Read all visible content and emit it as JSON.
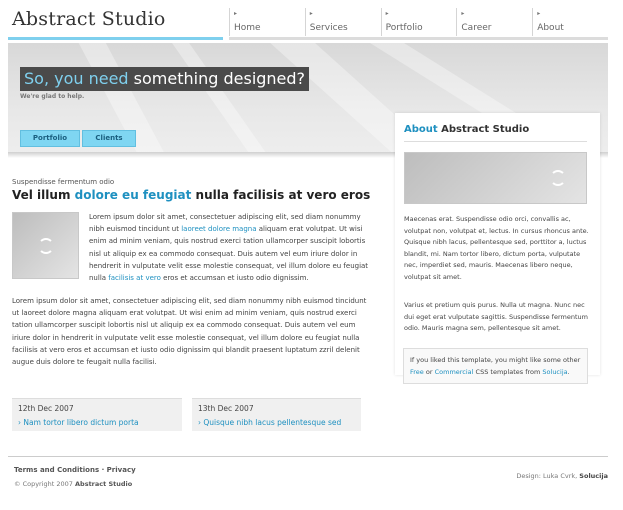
{
  "header": {
    "logo": "Abstract Studio",
    "nav": [
      {
        "label": "Home"
      },
      {
        "label": "Services"
      },
      {
        "label": "Portfolio"
      },
      {
        "label": "Career"
      },
      {
        "label": "About"
      }
    ]
  },
  "banner": {
    "title_highlight": "So, you need",
    "title_rest": " something designed?",
    "subtitle": "We're glad to help.",
    "buttons": [
      "Portfolio",
      "Clients"
    ]
  },
  "main": {
    "kicker": "Suspendisse fermentum odio",
    "headline_a": "Vel illum ",
    "headline_link": "dolore eu feugiat",
    "headline_b": " nulla facilisis at vero eros",
    "para1_a": "Lorem ipsum dolor sit amet, consectetuer adipiscing elit, sed diam nonummy nibh euismod tincidunt ut ",
    "para1_link1": "laoreet dolore magna",
    "para1_b": " aliquam erat volutpat. Ut wisi enim ad minim veniam, quis nostrud exerci tation ullamcorper suscipit lobortis nisl ut aliquip ex ea commodo consequat. Duis autem vel eum iriure dolor in hendrerit in vulputate velit esse molestie consequat, vel illum dolore eu feugiat nulla ",
    "para1_link2": "facilisis at vero",
    "para1_c": " eros et accumsan et iusto odio dignissim.",
    "para2": "Lorem ipsum dolor sit amet, consectetuer adipiscing elit, sed diam nonummy nibh euismod tincidunt ut laoreet dolore magna aliquam erat volutpat. Ut wisi enim ad minim veniam, quis nostrud exerci tation ullamcorper suscipit lobortis nisl ut aliquip ex ea commodo consequat. Duis autem vel eum iriure dolor in hendrerit in vulputate velit esse molestie consequat, vel illum dolore eu feugiat nulla facilisis at vero eros et accumsan et iusto odio dignissim qui blandit praesent luptatum zzril delenit augue duis dolore te feugait nulla facilisi.",
    "news": [
      {
        "date": "12th Dec 2007",
        "link": "› Nam tortor libero dictum porta"
      },
      {
        "date": "13th Dec 2007",
        "link": "› Quisque nibh lacus pellentesque sed"
      }
    ]
  },
  "sidebar": {
    "title_a": "About",
    "title_b": " Abstract Studio",
    "para1": "Maecenas erat. Suspendisse odio orci, convallis ac, volutpat non, volutpat et, lectus. In cursus rhoncus ante. Quisque nibh lacus, pellentesque sed, porttitor a, luctus blandit, mi. Nam tortor libero, dictum porta, vulputate nec, imperdiet sed, mauris. Maecenas libero neque, volutpat sit amet.",
    "para2": "Varius et pretium quis purus. Nulla ut magna. Nunc nec dui eget erat vulputate sagittis. Suspendisse fermentum odio. Mauris magna sem, pellentesque sit amet.",
    "promo_a": "If you liked this template, you might like some other ",
    "promo_free": "Free",
    "promo_or": " or ",
    "promo_commercial": "Commercial",
    "promo_b": " CSS templates from ",
    "promo_solucija": "Solucija",
    "promo_c": "."
  },
  "footer": {
    "links": "Terms and Conditions · Privacy",
    "copy_a": "© Copyright 2007 ",
    "copy_b": "Abstract Studio",
    "design_a": "Design: Luka Cvrk, ",
    "design_b": "Solucija"
  },
  "colors": {
    "accent": "#1e90c0",
    "button": "#7fd6f2",
    "banner_title_bg": "#4a4a4a"
  },
  "icons": [
    "loading-spinner-icon",
    "nav-arrow-icon"
  ]
}
